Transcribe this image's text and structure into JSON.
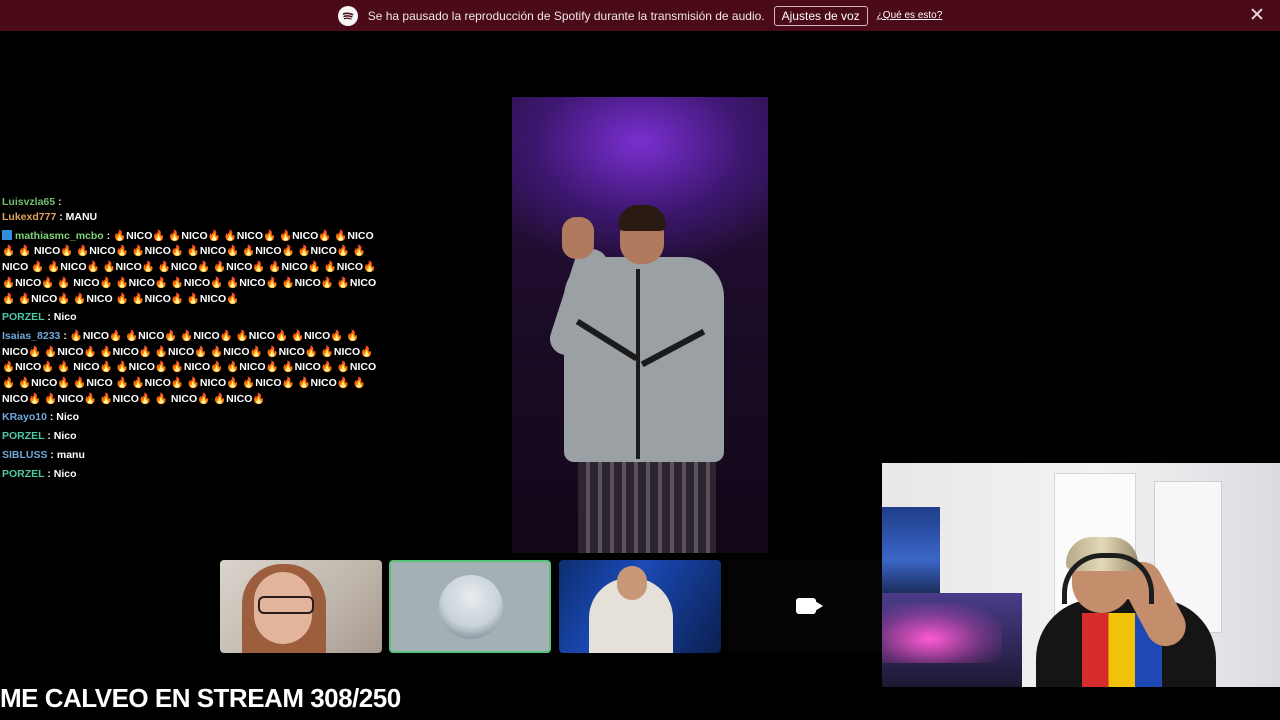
{
  "notification": {
    "message": "Se ha pausado la reproducción de Spotify durante la transmisión de audio.",
    "button": "Ajustes de voz",
    "link": "¿Qué es esto?",
    "icon": "spotify-icon",
    "bg_color": "#4a0a17"
  },
  "chat": [
    {
      "user": "Luisvzla65",
      "color": "#7fd37b",
      "text": ""
    },
    {
      "user": "Lukexd777",
      "color": "#e3a35b",
      "text": "MANU"
    },
    {
      "user": "mathiasmc_mcbo",
      "color": "#7fd37b",
      "badge": "moderator",
      "text": "🔥NICO🔥 🔥NICO🔥 🔥NICO🔥 🔥NICO🔥 🔥NICO🔥 🔥 NICO🔥 🔥NICO🔥 🔥NICO🔥 🔥NICO🔥 🔥NICO🔥 🔥NICO🔥 🔥NICO 🔥 🔥NICO🔥 🔥NICO🔥 🔥NICO🔥 🔥NICO🔥 🔥NICO🔥 🔥NICO🔥 🔥NICO🔥 🔥 NICO🔥 🔥NICO🔥 🔥NICO🔥 🔥NICO🔥 🔥NICO🔥 🔥NICO🔥 🔥NICO🔥 🔥NICO 🔥 🔥NICO🔥 🔥NICO🔥"
    },
    {
      "user": "PORZEL",
      "color": "#4ec9a6",
      "text": "Nico"
    },
    {
      "user": "Isaias_8233",
      "color": "#6fa8dc",
      "text": "🔥NICO🔥 🔥NICO🔥 🔥NICO🔥 🔥NICO🔥 🔥NICO🔥 🔥NICO🔥 🔥NICO🔥 🔥NICO🔥 🔥NICO🔥 🔥NICO🔥 🔥NICO🔥 🔥NICO🔥 🔥NICO🔥 🔥 NICO🔥 🔥NICO🔥 🔥NICO🔥 🔥NICO🔥 🔥NICO🔥 🔥NICO🔥 🔥NICO🔥 🔥NICO 🔥 🔥NICO🔥 🔥NICO🔥 🔥NICO🔥 🔥NICO🔥 🔥NICO🔥 🔥NICO🔥 🔥NICO🔥 🔥 NICO🔥 🔥NICO🔥"
    },
    {
      "user": "KRayo10",
      "color": "#6fa8dc",
      "text": "Nico"
    },
    {
      "user": "PORZEL",
      "color": "#4ec9a6",
      "text": "Nico"
    },
    {
      "user": "SIBLUSS",
      "color": "#6fa8dc",
      "text": "manu"
    },
    {
      "user": "PORZEL",
      "color": "#4ec9a6",
      "text": "Nico"
    }
  ],
  "participants": [
    {
      "name": "tile-1",
      "active": false
    },
    {
      "name": "tile-2",
      "active": true
    },
    {
      "name": "tile-3",
      "active": false
    },
    {
      "name": "tile-4",
      "active": false,
      "icon": "video-camera-icon"
    }
  ],
  "overlay_text": "ME CALVEO EN STREAM 308/250"
}
